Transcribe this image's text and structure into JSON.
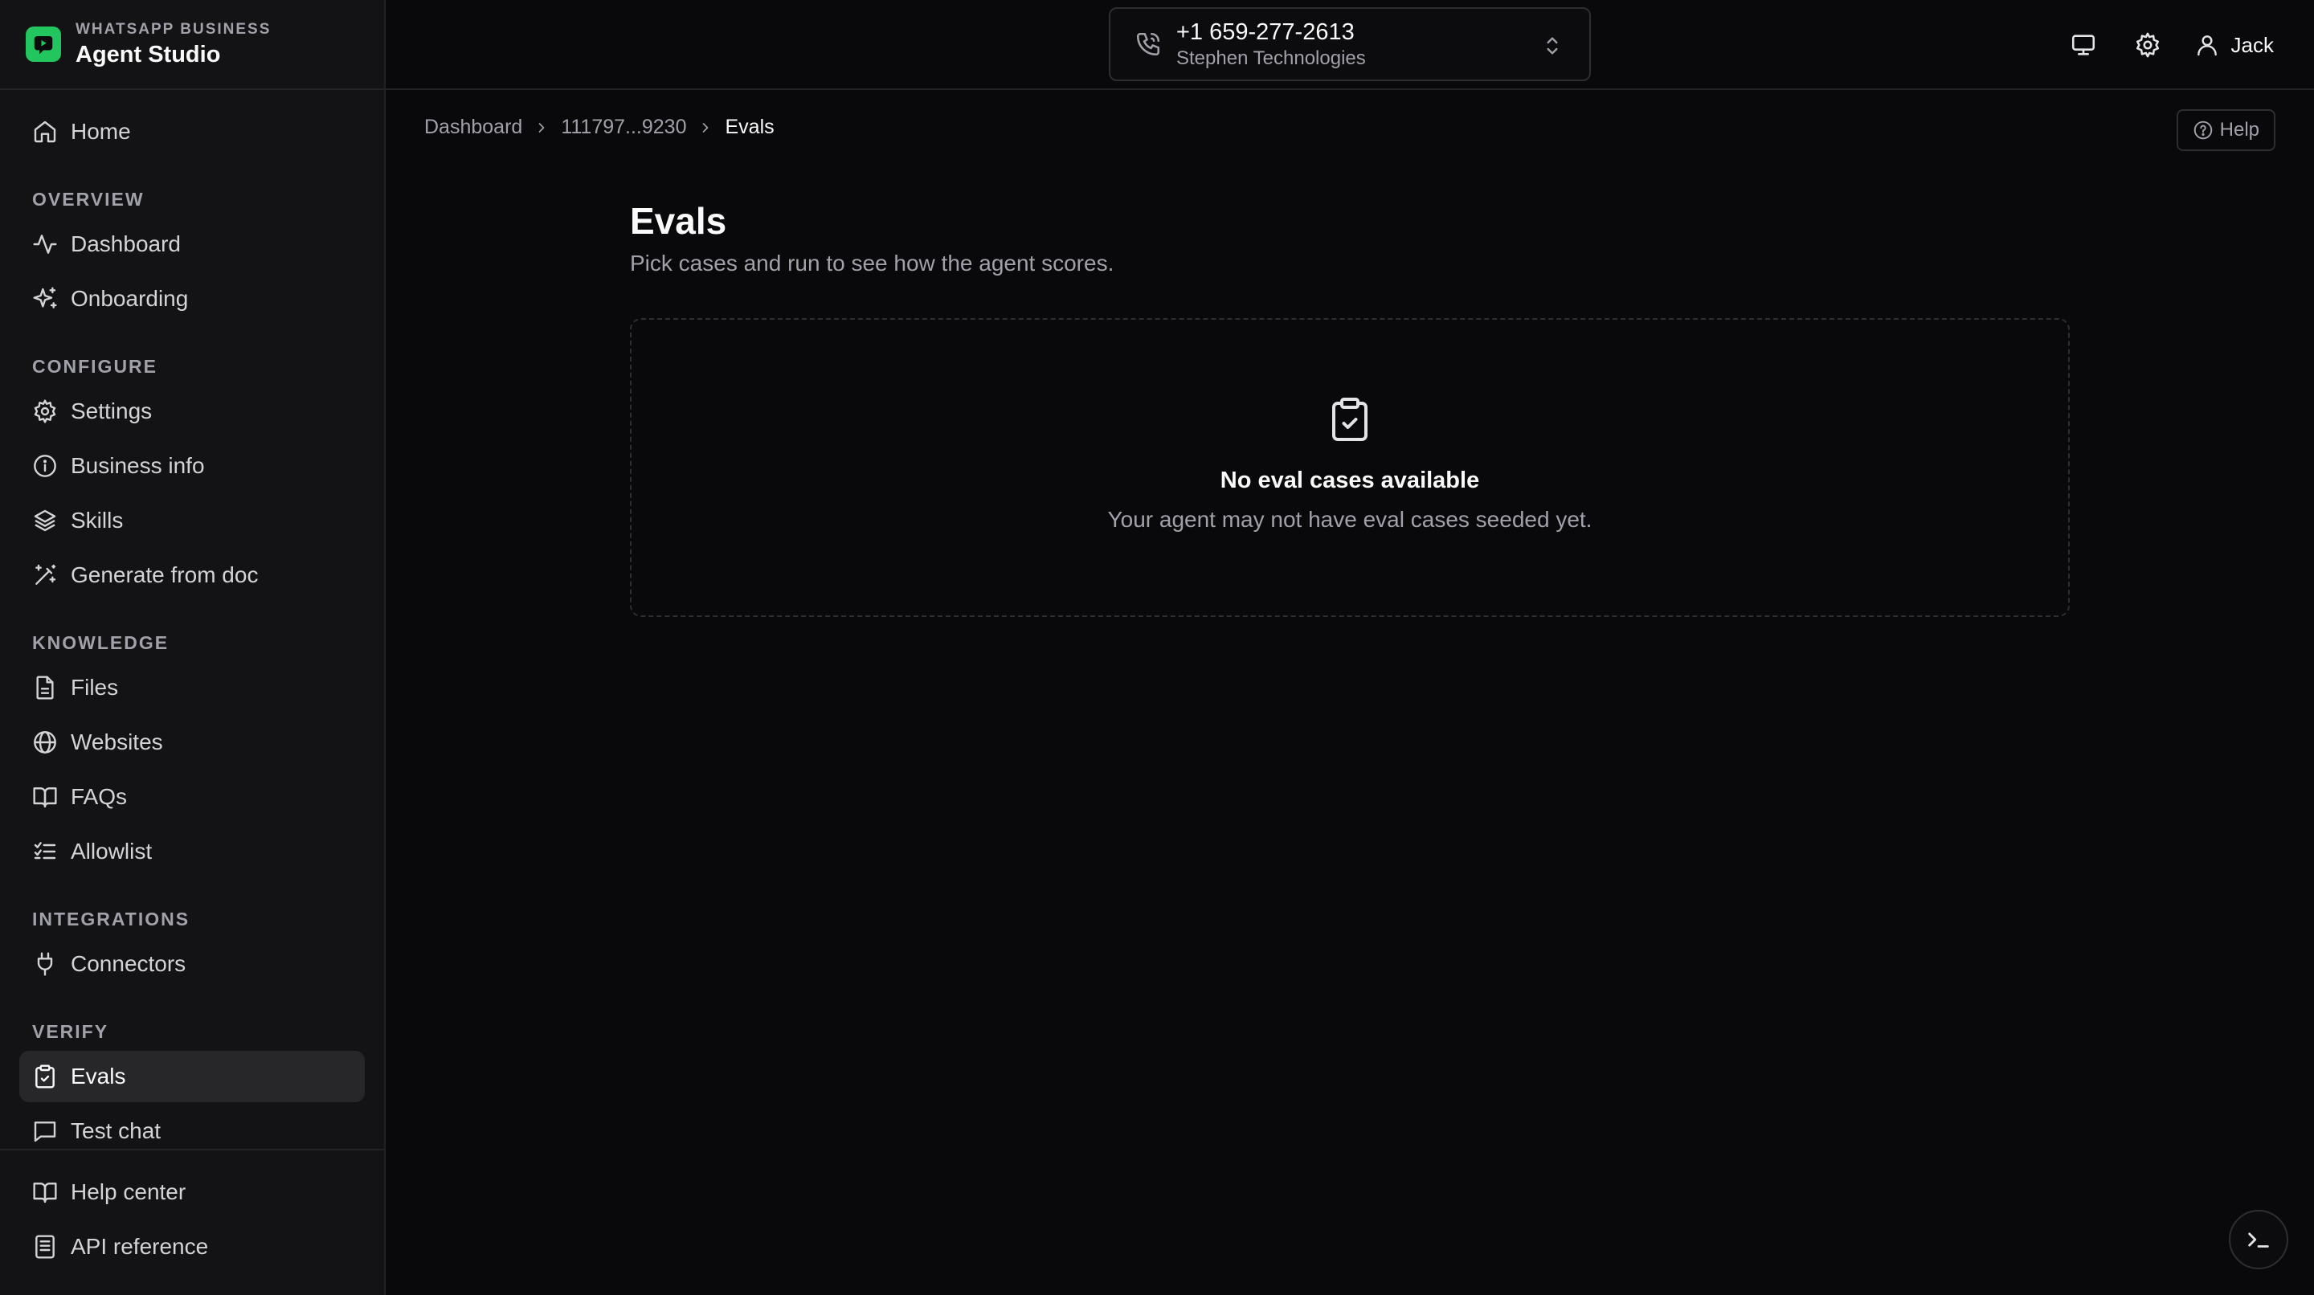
{
  "brand": {
    "eyebrow": "WHATSAPP BUSINESS",
    "title": "Agent Studio",
    "accent": "#22c55e"
  },
  "sidebar": {
    "home": {
      "label": "Home",
      "icon": "home-icon"
    },
    "sections": [
      {
        "label": "OVERVIEW",
        "items": [
          {
            "label": "Dashboard",
            "icon": "activity-icon"
          },
          {
            "label": "Onboarding",
            "icon": "sparkles-icon"
          }
        ]
      },
      {
        "label": "CONFIGURE",
        "items": [
          {
            "label": "Settings",
            "icon": "gear-icon"
          },
          {
            "label": "Business info",
            "icon": "info-icon"
          },
          {
            "label": "Skills",
            "icon": "layers-icon"
          },
          {
            "label": "Generate from doc",
            "icon": "wand-icon"
          }
        ]
      },
      {
        "label": "KNOWLEDGE",
        "items": [
          {
            "label": "Files",
            "icon": "file-icon"
          },
          {
            "label": "Websites",
            "icon": "globe-icon"
          },
          {
            "label": "FAQs",
            "icon": "book-icon"
          },
          {
            "label": "Allowlist",
            "icon": "list-checks-icon"
          }
        ]
      },
      {
        "label": "INTEGRATIONS",
        "items": [
          {
            "label": "Connectors",
            "icon": "plug-icon"
          }
        ]
      },
      {
        "label": "VERIFY",
        "items": [
          {
            "label": "Evals",
            "icon": "clipboard-check-icon",
            "active": true
          },
          {
            "label": "Test chat",
            "icon": "message-icon"
          }
        ]
      }
    ],
    "footer": [
      {
        "label": "Help center",
        "icon": "book-icon"
      },
      {
        "label": "API reference",
        "icon": "document-icon"
      }
    ]
  },
  "topbar": {
    "phone_number": "+1 659-277-2613",
    "organization": "Stephen Technologies",
    "user_name": "Jack"
  },
  "breadcrumb": {
    "root": "Dashboard",
    "agent": "111797...9230",
    "current": "Evals"
  },
  "help_label": "Help",
  "page": {
    "title": "Evals",
    "subtitle": "Pick cases and run to see how the agent scores.",
    "empty_title": "No eval cases available",
    "empty_description": "Your agent may not have eval cases seeded yet."
  }
}
